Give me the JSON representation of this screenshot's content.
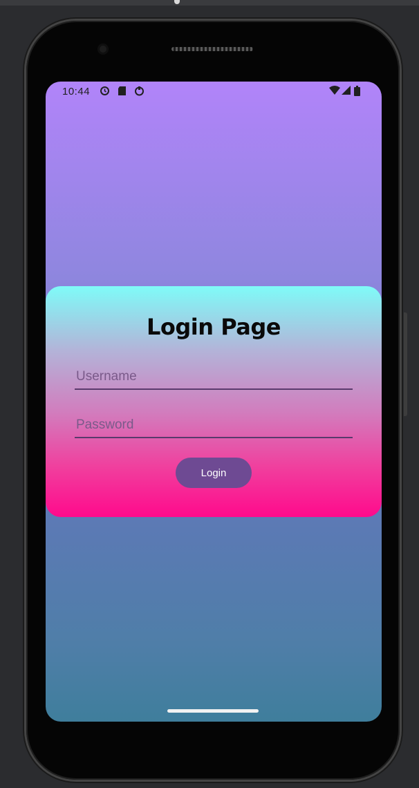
{
  "status_bar": {
    "time": "10:44",
    "left_icons": [
      "alarm-icon",
      "sd-card-icon",
      "sync-icon"
    ],
    "right_icons": [
      "wifi-icon",
      "signal-icon",
      "battery-icon"
    ]
  },
  "login_card": {
    "title": "Login Page",
    "username_placeholder": "Username",
    "username_value": "",
    "password_placeholder": "Password",
    "password_value": "",
    "login_label": "Login"
  },
  "colors": {
    "screen_top": "#b184f9",
    "screen_bottom": "#3f7e9c",
    "card_top": "#7ffbf8",
    "card_bottom": "#ff0a8c",
    "button": "#6e4a93"
  }
}
